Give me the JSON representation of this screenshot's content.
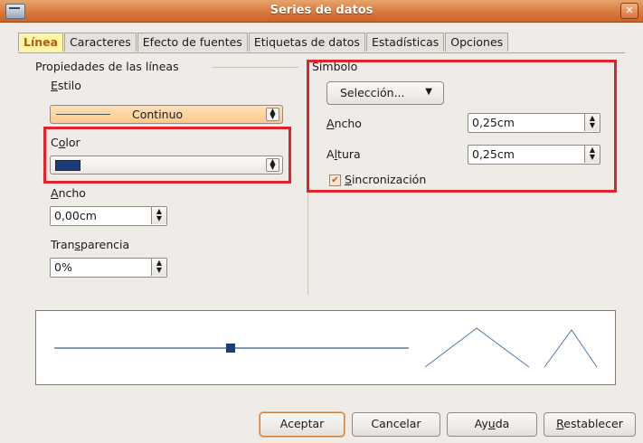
{
  "window": {
    "title": "Series de datos",
    "icon": "window-icon",
    "close_symbol": "✕"
  },
  "tabs": [
    {
      "label": "Línea",
      "active": true
    },
    {
      "label": "Caracteres"
    },
    {
      "label": "Efecto de fuentes"
    },
    {
      "label": "Etiquetas de datos"
    },
    {
      "label": "Estadísticas"
    },
    {
      "label": "Opciones"
    }
  ],
  "line_props": {
    "section_title": "Propiedades de las líneas",
    "style": {
      "label_pre": "",
      "label_ul": "E",
      "label_post": "stilo",
      "value": "Continuo"
    },
    "color": {
      "label_pre": "C",
      "label_ul": "o",
      "label_post": "lor",
      "swatch": "#1a3d7a"
    },
    "width": {
      "label_pre": "",
      "label_ul": "A",
      "label_post": "ncho",
      "value": "0,00cm"
    },
    "transparency": {
      "label_pre": "Tran",
      "label_ul": "s",
      "label_post": "parencia",
      "value": "0%"
    }
  },
  "symbol": {
    "section_title": "Símbolo",
    "select_label": "Selección...",
    "width": {
      "label_pre": "",
      "label_ul": "A",
      "label_post": "ncho",
      "value": "0,25cm"
    },
    "height": {
      "label_pre": "A",
      "label_ul": "l",
      "label_post": "tura",
      "value": "0,25cm"
    },
    "sync": {
      "label_pre": "",
      "label_ul": "S",
      "label_post": "incronización",
      "checked": true
    }
  },
  "buttons": {
    "ok": "Aceptar",
    "cancel": "Cancelar",
    "help_pre": "Ay",
    "help_ul": "u",
    "help_post": "da",
    "reset_pre": "",
    "reset_ul": "R",
    "reset_post": "establecer"
  },
  "colors": {
    "accent": "#d9783d",
    "highlight": "#e2232b",
    "series": "#1a3d7a"
  }
}
